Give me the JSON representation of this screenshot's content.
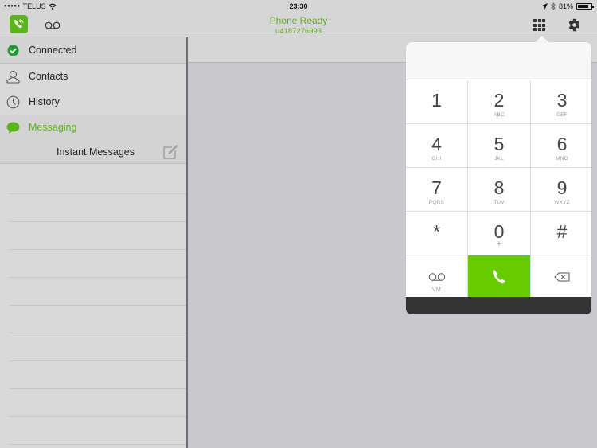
{
  "status_bar": {
    "signal_dots": "●●●●●",
    "carrier": "TELUS",
    "time": "23:30",
    "battery_percent": "81%",
    "battery_level": 0.81
  },
  "header": {
    "title": "Phone Ready",
    "subtitle": "u4187276993",
    "accent_color": "#64a82a"
  },
  "sidebar": {
    "status": {
      "label": "Connected",
      "icon": "check-circle-icon"
    },
    "items": [
      {
        "label": "Contacts",
        "icon": "person-icon"
      },
      {
        "label": "History",
        "icon": "clock-icon"
      },
      {
        "label": "Messaging",
        "icon": "speech-bubble-icon",
        "active": true
      }
    ],
    "submenu": {
      "label": "Instant Messages",
      "icon": "compose-icon"
    },
    "message_list_rows": 10
  },
  "dialpad": {
    "display_value": "",
    "keys": [
      {
        "digit": "1",
        "letters": ""
      },
      {
        "digit": "2",
        "letters": "ABC"
      },
      {
        "digit": "3",
        "letters": "DEF"
      },
      {
        "digit": "4",
        "letters": "GHI"
      },
      {
        "digit": "5",
        "letters": "JKL"
      },
      {
        "digit": "6",
        "letters": "MNO"
      },
      {
        "digit": "7",
        "letters": "PQRS"
      },
      {
        "digit": "8",
        "letters": "TUV"
      },
      {
        "digit": "9",
        "letters": "WXYZ"
      },
      {
        "digit": "*",
        "letters": ""
      },
      {
        "digit": "0",
        "letters": "+"
      },
      {
        "digit": "#",
        "letters": ""
      }
    ],
    "voicemail_label": "VM",
    "call_color": "#66cc00"
  }
}
